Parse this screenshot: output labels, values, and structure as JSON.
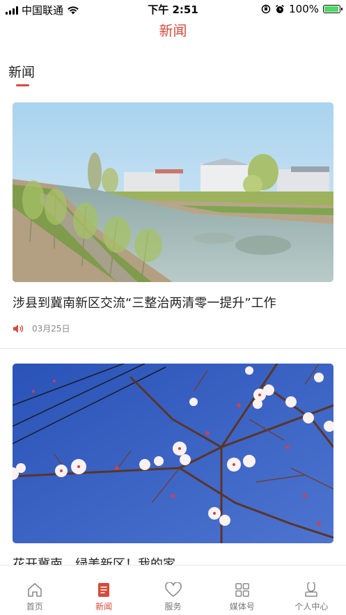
{
  "status_bar": {
    "carrier": "中国联通",
    "time": "下午 2:51",
    "battery_percent": "100%"
  },
  "nav": {
    "title": "新闻"
  },
  "section": {
    "title": "新闻"
  },
  "articles": [
    {
      "title": "涉县到冀南新区交流“三整治两清零一提升”工作",
      "date": "03月25日",
      "has_audio": true,
      "image": "canal-village-photo"
    },
    {
      "title": "花开冀南，绿美新区！我的家",
      "image": "apricot-blossom-photo"
    }
  ],
  "tab_bar": {
    "items": [
      {
        "label": "首页",
        "icon": "home-icon",
        "active": false
      },
      {
        "label": "新闻",
        "icon": "news-icon",
        "active": true
      },
      {
        "label": "服务",
        "icon": "heart-icon",
        "active": false
      },
      {
        "label": "媒体号",
        "icon": "grid-icon",
        "active": false
      },
      {
        "label": "个人中心",
        "icon": "person-icon",
        "active": false
      }
    ]
  },
  "colors": {
    "accent": "#d64b3b",
    "battery": "#4cd964"
  }
}
